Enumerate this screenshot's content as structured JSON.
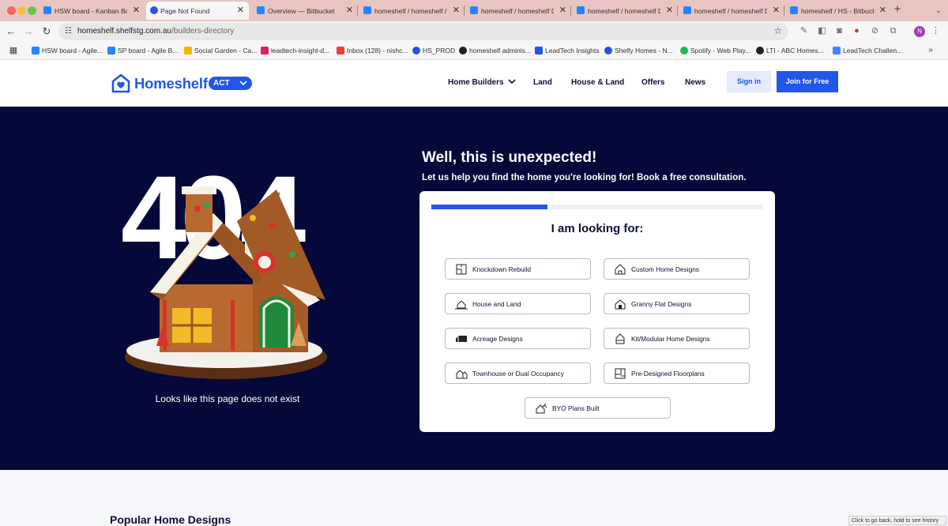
{
  "browser": {
    "tabs": [
      {
        "title": "HSW board - Kanban Boa",
        "favicon_color": "#2684ff"
      },
      {
        "title": "Page Not Found",
        "favicon_color": "#2157e8"
      },
      {
        "title": "Overview — Bitbucket",
        "favicon_color": "#2684ff"
      },
      {
        "title": "homeshelf / homeshelf / F",
        "favicon_color": "#2684ff"
      },
      {
        "title": "homeshelf / homeshelf Dr",
        "favicon_color": "#2684ff"
      },
      {
        "title": "homeshelf / homeshelf Dr",
        "favicon_color": "#2684ff"
      },
      {
        "title": "homeshelf / homeshelf Dr",
        "favicon_color": "#2684ff"
      },
      {
        "title": "homeshelf / HS - Bitbuck",
        "favicon_color": "#2684ff"
      }
    ],
    "new_tab": "+",
    "url_host": "homeshelf.shelfstg.com.au",
    "url_path": "/builders-directory",
    "bookmarks": [
      {
        "label": "HSW board - Agile...",
        "color": "#2684ff"
      },
      {
        "label": "SP board - Agile B...",
        "color": "#2684ff"
      },
      {
        "label": "Social Garden - Ca...",
        "color": "#f4b400"
      },
      {
        "label": "leadtech-insight-d...",
        "color": "#e01e5a"
      },
      {
        "label": "Inbox (128) - nishc...",
        "color": "#ea4335"
      },
      {
        "label": "HS_PROD",
        "color": "#2157e8"
      },
      {
        "label": "homeshelf adminis...",
        "color": "#222222"
      },
      {
        "label": "LeadTech Insights",
        "color": "#2157e8"
      },
      {
        "label": "Shelfy Homes - N...",
        "color": "#2157e8"
      },
      {
        "label": "Spotify - Web Play...",
        "color": "#1db954"
      },
      {
        "label": "LTI - ABC Homes...",
        "color": "#222222"
      },
      {
        "label": "LeadTech Challen...",
        "color": "#4285f4"
      }
    ],
    "profile_initial": "N",
    "history_tooltip": "Click to go back, hold to see history"
  },
  "site": {
    "brand": "Homeshelf",
    "state": "ACT",
    "nav": [
      "Home Builders",
      "Land",
      "House & Land",
      "Offers",
      "News"
    ],
    "sign_in": "Sign in",
    "join": "Join for Free"
  },
  "hero": {
    "big_code": "404",
    "missing_text": "Looks like this page does not exist",
    "title": "Well, this is unexpected!",
    "subtitle": "Let us help you find the home you're looking for! Book a free consultation."
  },
  "wizard": {
    "progress": 0.35,
    "title": "I am looking for:",
    "options": [
      {
        "label": "Knockdown Rebuild",
        "icon": "knockdown-rebuild-icon"
      },
      {
        "label": "Custom Home Designs",
        "icon": "custom-home-icon"
      },
      {
        "label": "House and Land",
        "icon": "house-and-land-icon"
      },
      {
        "label": "Granny Flat Designs",
        "icon": "granny-flat-icon"
      },
      {
        "label": "Acreage Designs",
        "icon": "acreage-icon"
      },
      {
        "label": "Kit/Modular Home Designs",
        "icon": "modular-home-icon"
      },
      {
        "label": "Townhouse or Dual Occupancy",
        "icon": "townhouse-icon"
      },
      {
        "label": "Pre-Designed Floorplans",
        "icon": "floorplan-icon"
      },
      {
        "label": "BYO Plans Built",
        "icon": "byo-plans-icon"
      }
    ]
  },
  "next_section": {
    "title": "Popular Home Designs"
  },
  "colors": {
    "brand_blue": "#2157e8",
    "hero_bg": "#04093a",
    "tabstrip": "#e8c5c1"
  }
}
